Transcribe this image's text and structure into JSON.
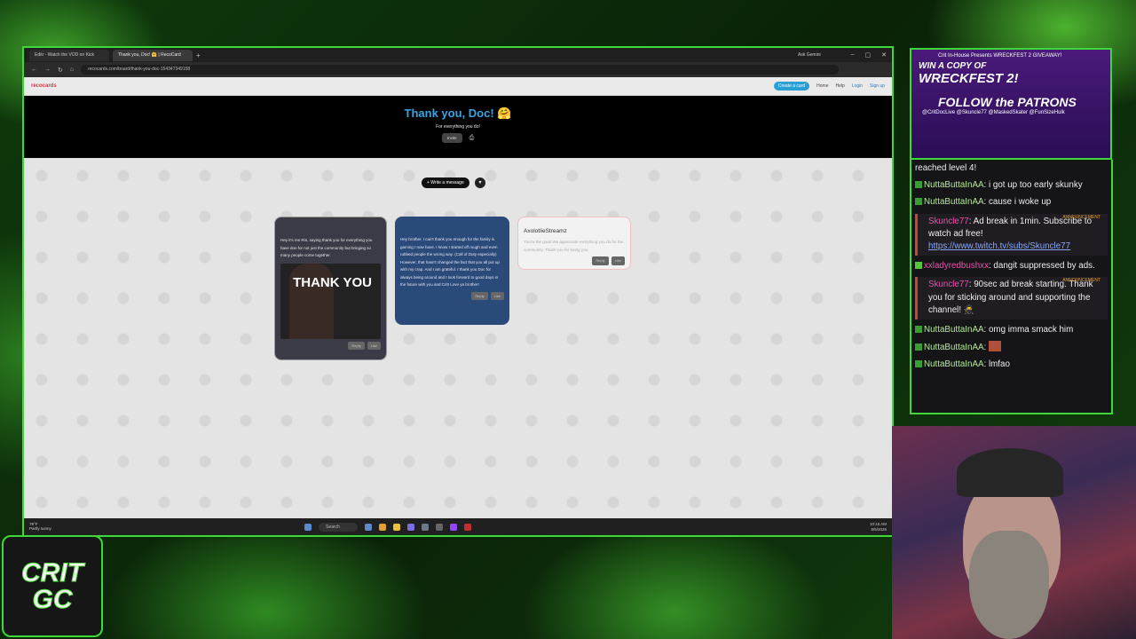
{
  "browser": {
    "tabs": [
      "Editr - Watch the VOD on Kick",
      "Thank you, Doc! 🤗 | RecoCard"
    ],
    "new_tab": "+",
    "ask": "Ask Gemini",
    "url": "recocards.com/board/thank-you-doc-154347349158"
  },
  "site": {
    "logo": "recocards",
    "create": "Create a card",
    "home": "Home",
    "help": "Help",
    "login": "Login",
    "signup": "Sign up"
  },
  "board": {
    "title": "Thank you, Doc! 🤗",
    "subtitle": "For everything you do!",
    "invite": "Invite",
    "write": "+ Write a message",
    "cards": [
      {
        "author": "",
        "text": "Hey it's me Rin, saying thank you for everything you have don for not just the community but bringing so many people come together.",
        "gif": "THANK YOU",
        "reply": "Reply",
        "like": "Like"
      },
      {
        "author": "",
        "text": "Hey brother. I can't thank you enough for the family is gaming I now have. I know I started off rough and even rubbed people the wrong way. (Call of Duty especially) However, that hasn't changed the fact that you all put up with my crap. And I am grateful. I thank you Doc for always being around and I look forward to good days in the future with you and Crit! Love ya brother!",
        "reply": "Reply",
        "like": "Like"
      },
      {
        "author": "AxolotlieStreamz",
        "text": "You're the goat! We appreciate everything you do for the community. Thank you for being you.",
        "reply": "Reply",
        "like": "Like"
      }
    ]
  },
  "taskbar": {
    "weather_temp": "79°F",
    "weather_desc": "Partly sunny",
    "search": "Search",
    "time": "10:15 AM",
    "date": "8/5/2025"
  },
  "stream": {
    "banner": {
      "line1": "Crit In-House Presents WRECKFEST 2 GIVEAWAY!",
      "line2": "WIN A COPY OF",
      "line3": "WRECKFEST 2!",
      "line4": "FOLLOW the PATRONS",
      "line5": "@CritDocLive @Skuncle77 @MaskedSkater @FunSizeHulk"
    },
    "chat": [
      {
        "type": "text",
        "text": "reached level 4!"
      },
      {
        "type": "msg",
        "user": "NuttaButtaInAA",
        "text": ": i got up too early skunky"
      },
      {
        "type": "msg",
        "user": "NuttaButtaInAA",
        "text": ": cause i woke up"
      },
      {
        "type": "ann",
        "user": "Skuncle77",
        "text": ": Ad break in 1min. Subscribe to watch ad free!",
        "link": "https://www.twitch.tv/subs/Skuncle77",
        "tag": "ANNOUNCEMENT"
      },
      {
        "type": "msg2",
        "user": "xxladyredbushxx",
        "text": ": dangit suppressed by ads."
      },
      {
        "type": "ann2",
        "user": "Skuncle77",
        "text": ": 90sec ad break starting. Thank you for sticking around and supporting the channel! 🥷",
        "tag": "ANNOUNCEMENT"
      },
      {
        "type": "msg",
        "user": "NuttaButtaInAA",
        "text": ": omg imma smack him"
      },
      {
        "type": "msg",
        "user": "NuttaButtaInAA",
        "text": ":"
      },
      {
        "type": "msg",
        "user": "NuttaButtaInAA",
        "text": ": lmfao"
      }
    ],
    "logo_line1": "CRIT",
    "logo_line2": "GC"
  }
}
